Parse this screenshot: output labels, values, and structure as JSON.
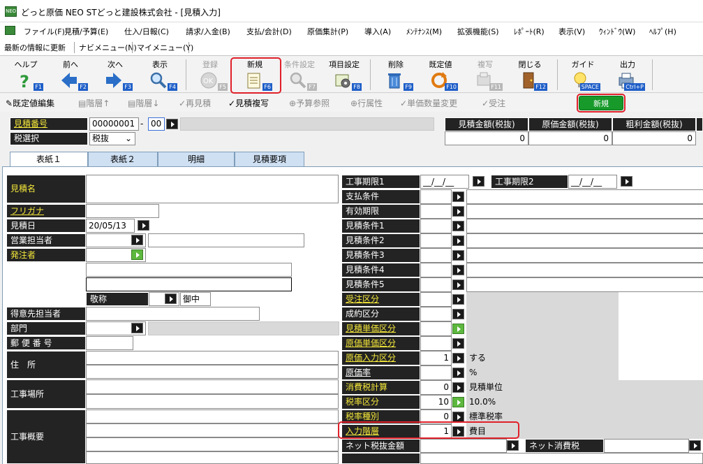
{
  "window": {
    "title": "どっと原価 NEO STどっと建設株式会社 - [見積入力]",
    "icon": "app-icon"
  },
  "menu": [
    "ファイル(F)",
    "見積/予算(E)",
    "仕入/日報(C)",
    "請求/入金(B)",
    "支払/会計(D)",
    "原価集計(P)",
    "導入(A)",
    "ﾒﾝﾃﾅﾝｽ(M)",
    "拡張機能(S)",
    "ﾚﾎﾟｰﾄ(R)",
    "表示(V)",
    "ｳｨﾝﾄﾞｳ(W)",
    "ﾍﾙﾌﾟ(H)"
  ],
  "nav": [
    "最新の情報に更新",
    "ナビメニュー(N)",
    "マイメニュー(Y)"
  ],
  "toolbar": [
    {
      "label": "ヘルプ",
      "key": "F1",
      "icon": "help-icon",
      "enabled": true
    },
    {
      "label": "前へ",
      "key": "F2",
      "icon": "arrow-left-icon",
      "enabled": true
    },
    {
      "label": "次へ",
      "key": "F3",
      "icon": "arrow-right-icon",
      "enabled": true
    },
    {
      "label": "表示",
      "key": "F4",
      "icon": "magnifier-icon",
      "enabled": true
    },
    {
      "label": "登録",
      "key": "F5",
      "icon": "ok-icon",
      "enabled": false
    },
    {
      "label": "新規",
      "key": "F6",
      "icon": "new-document-icon",
      "enabled": true
    },
    {
      "label": "条件設定",
      "key": "F7",
      "icon": "condition-search-icon",
      "enabled": false
    },
    {
      "label": "項目設定",
      "key": "F8",
      "icon": "item-settings-icon",
      "enabled": true
    },
    {
      "label": "削除",
      "key": "F9",
      "icon": "trash-icon",
      "enabled": true
    },
    {
      "label": "既定値",
      "key": "F10",
      "icon": "reset-icon",
      "enabled": true
    },
    {
      "label": "複写",
      "key": "F11",
      "icon": "copy-icon",
      "enabled": false
    },
    {
      "label": "閉じる",
      "key": "F12",
      "icon": "door-icon",
      "enabled": true
    },
    {
      "label": "ガイド",
      "key": "SPACE",
      "icon": "bulb-icon",
      "enabled": true
    },
    {
      "label": "出力",
      "key": "Ctrl+P",
      "icon": "printer-icon",
      "enabled": true
    }
  ],
  "subtoolbar": [
    {
      "label": "既定値編集",
      "icon": "edit-defaults-icon",
      "enabled": true
    },
    {
      "label": "階層↑",
      "icon": "level-up-icon",
      "enabled": false
    },
    {
      "label": "階層↓",
      "icon": "level-down-icon",
      "enabled": false
    },
    {
      "label": "再見積",
      "icon": "re-estimate-icon",
      "enabled": false
    },
    {
      "label": "見積複写",
      "icon": "estimate-copy-icon",
      "enabled": true
    },
    {
      "label": "予算参照",
      "icon": "budget-ref-icon",
      "enabled": false
    },
    {
      "label": "行属性",
      "icon": "row-attr-icon",
      "enabled": false
    },
    {
      "label": "単価数量変更",
      "icon": "price-qty-icon",
      "enabled": false
    },
    {
      "label": "受注",
      "icon": "order-icon",
      "enabled": false
    }
  ],
  "mode_badge": "新規",
  "header": {
    "estimate_no_label": "見積番号",
    "estimate_no": "00000001",
    "dash": "-",
    "branch_no": "00",
    "tax_label": "税選択",
    "tax_value": "税抜"
  },
  "totals": {
    "headers": [
      "見積金額(税抜)",
      "原価金額(税抜)",
      "粗利金額(税抜)"
    ],
    "values": [
      "0",
      "0",
      "0"
    ]
  },
  "tabs": [
    "表紙１",
    "表紙２",
    "明細",
    "見積要項"
  ],
  "left_labels": {
    "name": "見積名",
    "kana": "フリガナ",
    "date": "見積日",
    "sales": "営業担当者",
    "orderer": "発注者",
    "honorific": "敬称",
    "client_rep": "得意先担当者",
    "dept": "部門",
    "zip": "郵 便 番 号",
    "address": "住　所",
    "site": "工事場所",
    "overview": "工事概要"
  },
  "left_values": {
    "date": "20/05/13",
    "honorific": "御中"
  },
  "right_top": {
    "period1_label": "工事期限1",
    "period1_value": "__/__/__",
    "period2_label": "工事期限2",
    "period2_value": "__/__/__"
  },
  "right_rows": [
    {
      "label": "支払条件",
      "value": "",
      "desc": ""
    },
    {
      "label": "有効期限",
      "value": "",
      "desc": ""
    },
    {
      "label": "見積条件1",
      "value": "",
      "desc": ""
    },
    {
      "label": "見積条件2",
      "value": "",
      "desc": ""
    },
    {
      "label": "見積条件3",
      "value": "",
      "desc": ""
    },
    {
      "label": "見積条件4",
      "value": "",
      "desc": ""
    },
    {
      "label": "見積条件5",
      "value": "",
      "desc": ""
    },
    {
      "label": "受注区分",
      "value": "",
      "desc": ""
    },
    {
      "label": "成約区分",
      "value": "",
      "desc": ""
    },
    {
      "label": "見積単価区分",
      "value": "",
      "desc": ""
    },
    {
      "label": "原価単価区分",
      "value": "",
      "desc": ""
    },
    {
      "label": "原価入力区分",
      "value": "1",
      "desc": "する"
    },
    {
      "label": "原価率",
      "value": "",
      "desc": "%"
    },
    {
      "label": "消費税計算",
      "value": "0",
      "desc": "見積単位"
    },
    {
      "label": "税率区分",
      "value": "10",
      "desc": "10.0%"
    },
    {
      "label": "税率種別",
      "value": "0",
      "desc": "標準税率"
    },
    {
      "label": "入力階層",
      "value": "1",
      "desc": "費目"
    }
  ],
  "bottom": {
    "net_label": "ネット税抜金額",
    "net_tax_label": "ネット消費税"
  }
}
